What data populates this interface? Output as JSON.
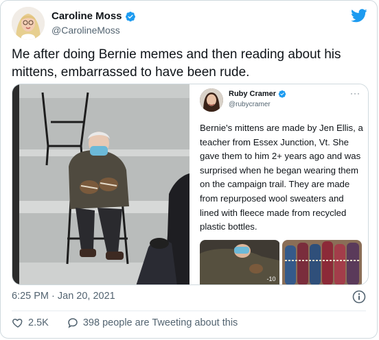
{
  "author": {
    "name": "Caroline Moss",
    "handle": "@CarolineMoss"
  },
  "tweet": {
    "text": "Me after doing Bernie memes and then reading about his mittens, embarrassed to have been rude.",
    "timestamp": "6:25 PM · Jan 20, 2021"
  },
  "quoted": {
    "name": "Ruby Cramer",
    "handle": "@rubycramer",
    "more": "···",
    "text": "Bernie's mittens are made by Jen Ellis, a teacher from Essex Junction, Vt. She gave them to him 2+ years ago and was surprised when he began wearing them on the campaign trail. They are made from repurposed wool sweaters and lined with fleece made from recycled plastic bottles.",
    "video_overlay": "-10"
  },
  "actions": {
    "likes": "2.5K",
    "conversation": "398 people are Tweeting about this"
  },
  "icons": {
    "logo": "twitter-bird-icon",
    "verified": "verified-badge-icon",
    "info": "info-icon",
    "like": "heart-icon",
    "reply": "speech-bubble-icon"
  },
  "colors": {
    "twitter_blue": "#1d9bf0",
    "text": "#0f1419",
    "muted": "#536471",
    "border": "#cfd9de"
  }
}
